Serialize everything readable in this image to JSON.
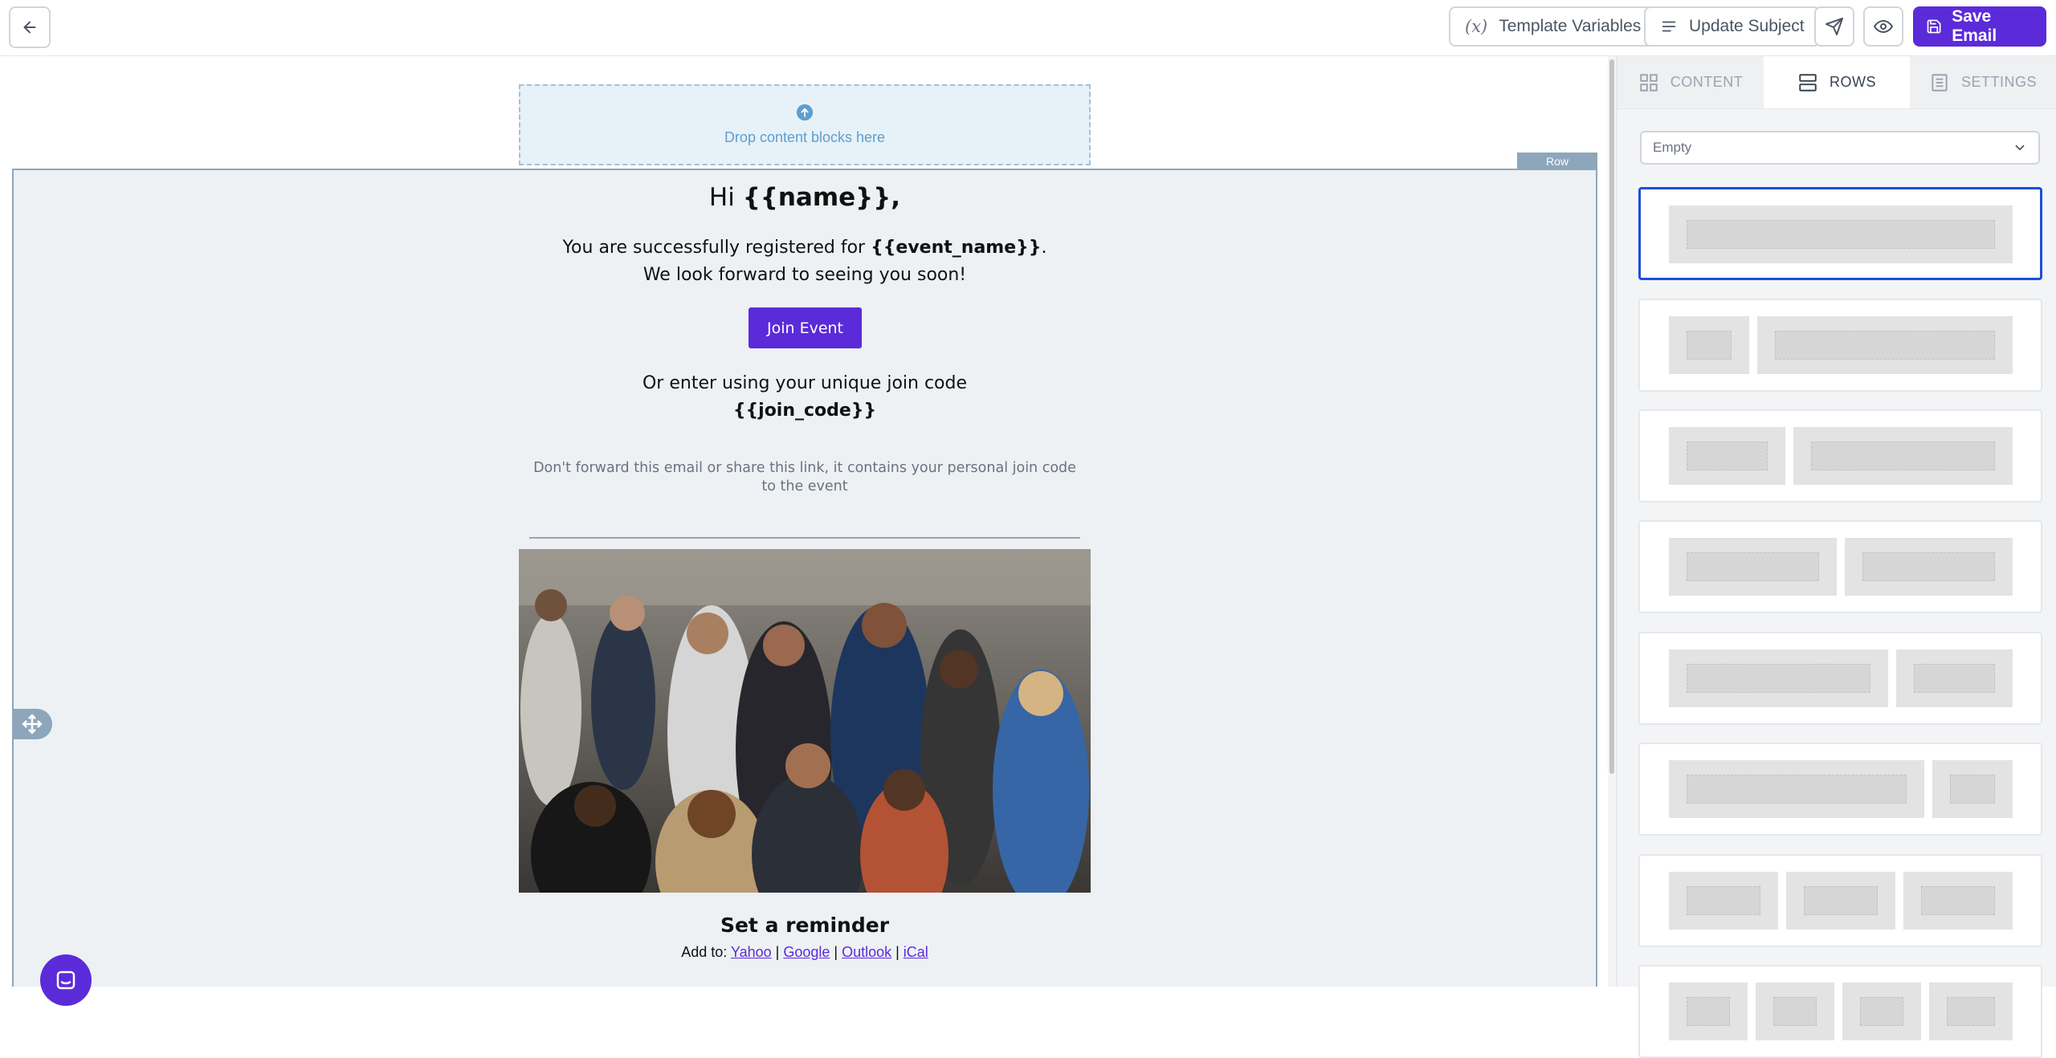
{
  "topbar": {
    "template_variables_label": "Template Variables",
    "template_variables_glyph": "(x)",
    "update_subject_label": "Update Subject",
    "save_label": "Save Email",
    "icons": [
      "arrow-left-icon",
      "variables-icon",
      "lines-icon",
      "send-icon",
      "eye-icon",
      "save-icon"
    ]
  },
  "canvas": {
    "dropzone_text": "Drop content blocks here",
    "row_label": "Row"
  },
  "email": {
    "greeting_prefix": "Hi ",
    "greeting_var": "{{name}},",
    "registered_prefix": "You are successfully registered for ",
    "registered_var": "{{event_name}}",
    "registered_suffix": ".",
    "look_forward": "We look forward to seeing you soon!",
    "join_button": "Join Event",
    "join_code_intro": "Or enter using your unique join code",
    "join_code_var": "{{join_code}}",
    "notice": "Don't forward this email or share this link, it contains your personal join code to the event",
    "reminder_title": "Set a reminder",
    "add_to_label": "Add to:",
    "calendar_links": [
      "Yahoo",
      "Google",
      "Outlook",
      "iCal"
    ],
    "link_separator": " | "
  },
  "panel": {
    "tabs": [
      {
        "label": "CONTENT",
        "icon": "grid-icon",
        "active": false
      },
      {
        "label": "ROWS",
        "icon": "rows-icon",
        "active": true
      },
      {
        "label": "SETTINGS",
        "icon": "settings-icon",
        "active": false
      }
    ],
    "select_value": "Empty",
    "layouts_column_counts": [
      1,
      2,
      2,
      2,
      2,
      2,
      3
    ]
  },
  "colors": {
    "accent": "#5b2bd9",
    "row_border": "#8ea6bb",
    "dropzone_bg": "#e7f1f8",
    "selected_layout": "#1d4ed8"
  }
}
